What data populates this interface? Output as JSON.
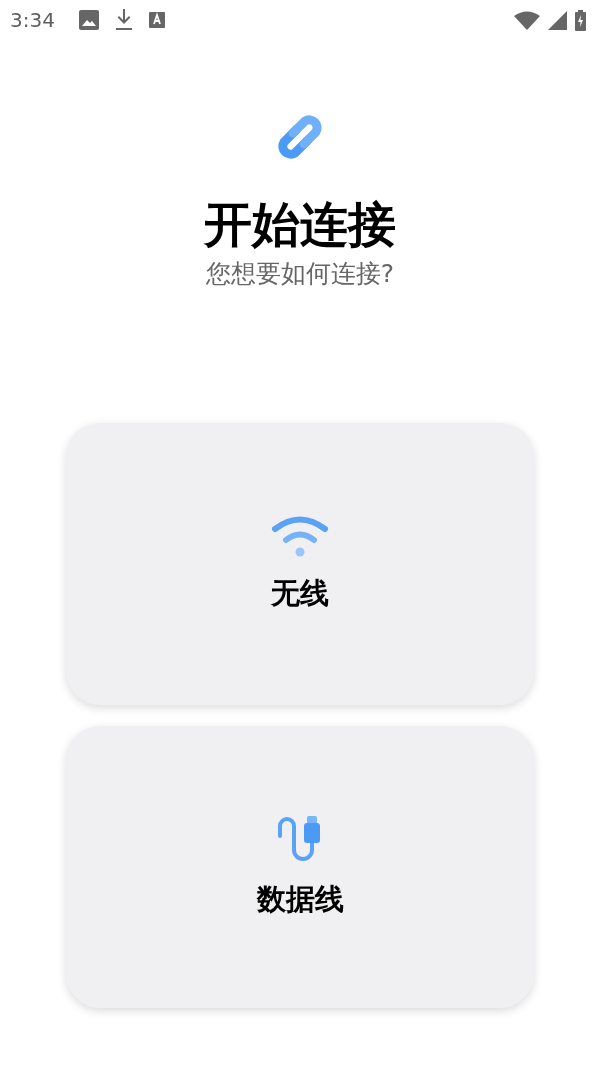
{
  "status_bar": {
    "time": "3:34"
  },
  "header": {
    "title": "开始连接",
    "subtitle": "您想要如何连接?"
  },
  "options": [
    {
      "kind": "wifi",
      "label": "无线"
    },
    {
      "kind": "cable",
      "label": "数据线"
    }
  ]
}
